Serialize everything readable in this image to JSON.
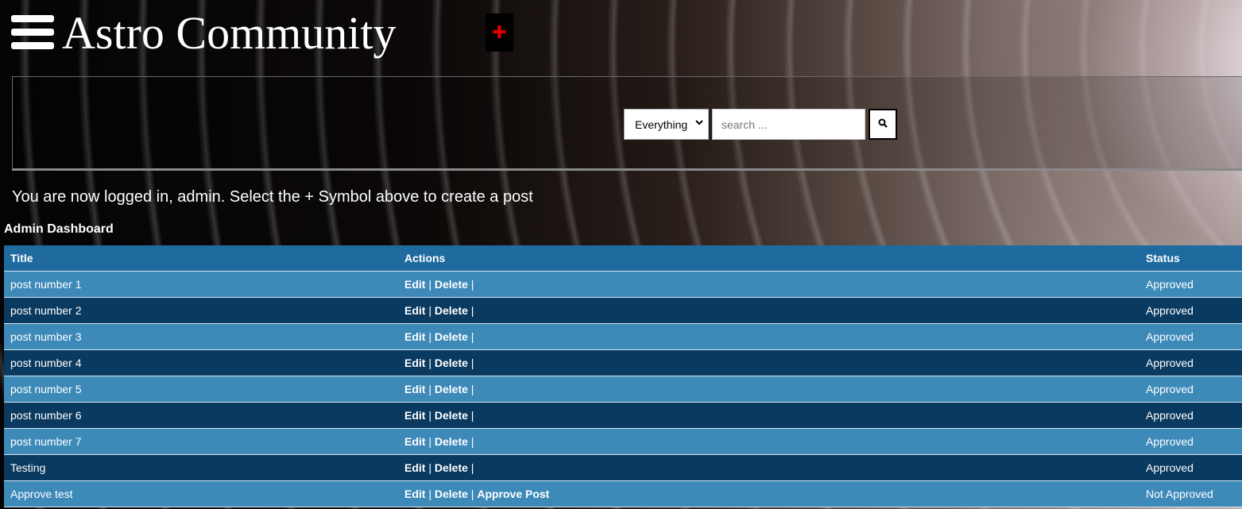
{
  "header": {
    "site_title": "Astro Community",
    "menu_icon": "hamburger-menu-icon",
    "create_icon": "plus-icon",
    "create_color": "#e00000"
  },
  "search": {
    "scope_selected": "Everything",
    "placeholder": "search ...",
    "button_icon": "search-icon"
  },
  "login_message": "You are now logged in, admin. Select the + Symbol above to create a post",
  "dashboard": {
    "title": "Admin Dashboard",
    "columns": [
      "Title",
      "Actions",
      "Status"
    ],
    "action_labels": {
      "edit": "Edit",
      "delete": "Delete",
      "approve": "Approve Post",
      "separator": "|"
    },
    "rows": [
      {
        "title": "post number 1",
        "status": "Approved",
        "approve": false
      },
      {
        "title": "post number 2",
        "status": "Approved",
        "approve": false
      },
      {
        "title": "post number 3",
        "status": "Approved",
        "approve": false
      },
      {
        "title": "post number 4",
        "status": "Approved",
        "approve": false
      },
      {
        "title": "post number 5",
        "status": "Approved",
        "approve": false
      },
      {
        "title": "post number 6",
        "status": "Approved",
        "approve": false
      },
      {
        "title": "post number 7",
        "status": "Approved",
        "approve": false
      },
      {
        "title": "Testing",
        "status": "Approved",
        "approve": false
      },
      {
        "title": "Approve test",
        "status": "Not Approved",
        "approve": true
      }
    ]
  },
  "colors": {
    "header_row": "#1f6a9f",
    "row_light": "#3d8ab9",
    "row_dark": "#0a3a60"
  }
}
